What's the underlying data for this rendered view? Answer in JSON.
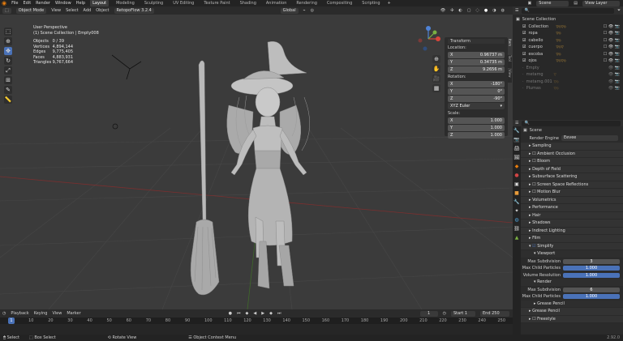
{
  "menus": [
    "File",
    "Edit",
    "Render",
    "Window",
    "Help"
  ],
  "workspaces": [
    "Layout",
    "Modeling",
    "Sculpting",
    "UV Editing",
    "Texture Paint",
    "Shading",
    "Animation",
    "Rendering",
    "Compositing",
    "Scripting"
  ],
  "scene": "Scene",
  "view_layer": "View Layer",
  "header": {
    "mode": "Object Mode",
    "view": "View",
    "select": "Select",
    "add": "Add",
    "object": "Object",
    "addon": "RetopoFlow 3.2.4",
    "orientation_label": "Orientation:",
    "orientation": "Default",
    "drag_label": "Drag:",
    "drag": "Select Box",
    "transform": "Global",
    "options": "Options"
  },
  "stats": {
    "line1": "User Perspective",
    "line2": "(1) Scene Collection | Empty008",
    "rows": [
      {
        "k": "Objects",
        "v": "0 / 39"
      },
      {
        "k": "Vertices",
        "v": "4,894,144"
      },
      {
        "k": "Edges",
        "v": "9,775,405"
      },
      {
        "k": "Faces",
        "v": "4,883,931"
      },
      {
        "k": "Triangles",
        "v": "9,767,664"
      }
    ]
  },
  "npanel": {
    "title": "Transform",
    "location": "Location:",
    "loc": [
      {
        "a": "X",
        "v": "0.96737 m"
      },
      {
        "a": "Y",
        "v": "0.34735 m"
      },
      {
        "a": "Z",
        "v": "9.2656 m"
      }
    ],
    "rotation": "Rotation:",
    "rot": [
      {
        "a": "X",
        "v": "-180°"
      },
      {
        "a": "Y",
        "v": "0°"
      },
      {
        "a": "Z",
        "v": "-90°"
      }
    ],
    "euler": "XYZ Euler",
    "scale": "Scale:",
    "sc": [
      {
        "a": "X",
        "v": "1.000"
      },
      {
        "a": "Y",
        "v": "1.000"
      },
      {
        "a": "Z",
        "v": "1.000"
      }
    ],
    "tabs": [
      "Item",
      "Tool",
      "View"
    ]
  },
  "outliner": {
    "root": "Scene Collection",
    "items": [
      "Collection",
      "ropa",
      "cabello",
      "cuerpo",
      "escoba",
      "ojos",
      "Empty",
      "metamg",
      "metamg.001",
      "Plumas"
    ]
  },
  "props": {
    "scene": "Scene",
    "engine_label": "Render Engine",
    "engine": "Eevee",
    "sections": [
      "Sampling",
      "Ambient Occlusion",
      "Bloom",
      "Depth of Field",
      "Subsurface Scattering",
      "Screen Space Reflections",
      "Motion Blur",
      "Volumetrics",
      "Performance",
      "Hair",
      "Shadows",
      "Indirect Lighting",
      "Film"
    ],
    "simplify": "Simplify",
    "viewport": "Viewport",
    "render": "Render",
    "grease": "Grease Pencil",
    "freestyle": "Freestyle",
    "vp_rows": [
      {
        "k": "Max Subdivision",
        "v": "3"
      },
      {
        "k": "Max Child Particles",
        "v": "1.000"
      },
      {
        "k": "Volume Resolution",
        "v": "1.000"
      }
    ],
    "r_rows": [
      {
        "k": "Max Subdivision",
        "v": "6"
      },
      {
        "k": "Max Child Particles",
        "v": "1.000"
      }
    ]
  },
  "timeline": {
    "playback": "Playback",
    "keying": "Keying",
    "view": "View",
    "marker": "Marker",
    "current": "1",
    "start_label": "Start",
    "start": "1",
    "end_label": "End",
    "end": "250",
    "ticks": [
      "0",
      "10",
      "20",
      "30",
      "40",
      "50",
      "60",
      "70",
      "80",
      "90",
      "100",
      "110",
      "120",
      "130",
      "140",
      "150",
      "160",
      "170",
      "180",
      "190",
      "200",
      "210",
      "220",
      "230",
      "240",
      "250"
    ]
  },
  "status": {
    "select": "Select",
    "box": "Box Select",
    "rotate": "Rotate View",
    "ctx": "Object Context Menu",
    "version": "2.92.0"
  }
}
